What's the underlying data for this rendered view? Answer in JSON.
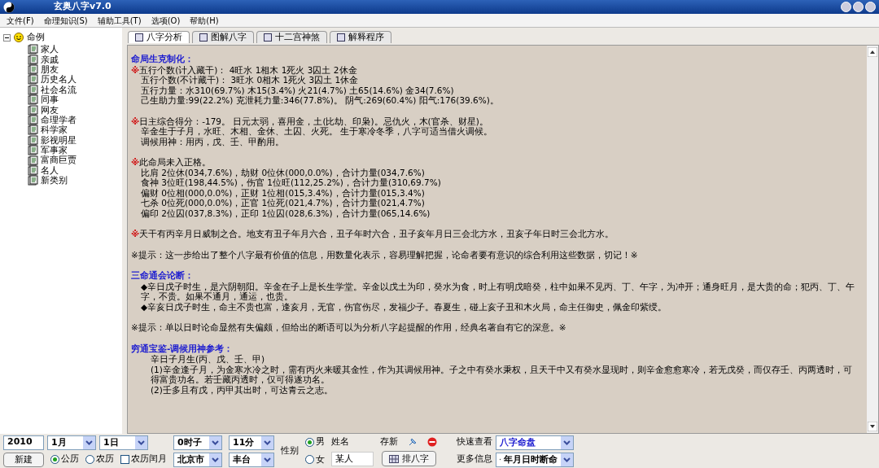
{
  "window": {
    "title": "玄奥八字v7.0"
  },
  "menu": [
    "文件(F)",
    "命理知识(S)",
    "辅助工具(T)",
    "选项(O)",
    "帮助(H)"
  ],
  "tree": {
    "label": "命例",
    "expanded": true,
    "children": [
      {
        "label": "家人"
      },
      {
        "label": "亲戚"
      },
      {
        "label": "朋友"
      },
      {
        "label": "历史名人"
      },
      {
        "label": "社会名流"
      },
      {
        "label": "同事"
      },
      {
        "label": "网友"
      },
      {
        "label": "命理学者"
      },
      {
        "label": "科学家"
      },
      {
        "label": "影视明星"
      },
      {
        "label": "军事家"
      },
      {
        "label": "富商巨贾"
      },
      {
        "label": "名人"
      },
      {
        "label": "新类别"
      }
    ]
  },
  "tabs": [
    {
      "label": "八字分析",
      "selected": true
    },
    {
      "label": "图解八字",
      "selected": false
    },
    {
      "label": "十二宫神煞",
      "selected": false
    },
    {
      "label": "解释程序",
      "selected": false
    }
  ],
  "content": [
    {
      "heading": "命局生克制化：",
      "lines": [
        {
          "marker": "※",
          "text": "五行个数(计入藏干)： 4旺水 1相木 1死火 3囚土 2休金"
        },
        {
          "text": "五行个数(不计藏干)： 3旺水 0相木 1死火 3囚土 1休金"
        },
        {
          "text": "五行力量：水310(69.7%)  木15(3.4%)  火21(4.7%)  土65(14.6%)  金34(7.6%)"
        },
        {
          "text": "己生助力量:99(22.2%)  克泄耗力量:346(77.8%)。  阴气:269(60.4%)  阳气:176(39.6%)。"
        }
      ]
    },
    {
      "lines": [
        {
          "marker": "※",
          "text": "日主综合得分：-179。 日元太弱，喜用金，土(比劫、印枭)。忌仇火，木(官杀、财星)。"
        },
        {
          "text": "辛金生于子月，水旺、木相、金休、土囚、火死。    生于寒冷冬季，八字可适当借火调候。"
        },
        {
          "text": "调候用神：用丙，戊、壬、甲酌用。"
        }
      ]
    },
    {
      "lines": [
        {
          "marker": "※",
          "text": "此命局未入正格。"
        },
        {
          "text": "比肩 2位休(034,7.6%)，劫财 0位休(000,0.0%)，合计力量(034,7.6%)"
        },
        {
          "text": "食神 3位旺(198,44.5%)，伤官 1位旺(112,25.2%)，合计力量(310,69.7%)"
        },
        {
          "text": "偏财 0位相(000,0.0%)，正财 1位相(015,3.4%)，合计力量(015,3.4%)"
        },
        {
          "text": "七杀 0位死(000,0.0%)，正官 1位死(021,4.7%)，合计力量(021,4.7%)"
        },
        {
          "text": "偏印 2位囚(037,8.3%)，正印 1位囚(028,6.3%)，合计力量(065,14.6%)"
        }
      ]
    },
    {
      "lines": [
        {
          "marker": "※",
          "text": "天干有丙辛月日威制之合。地支有丑子年月六合，丑子年时六合，丑子亥年月日三会北方水，丑亥子年日时三会北方水。"
        }
      ]
    },
    {
      "lines": [
        {
          "kind": "note",
          "text": "※提示：这一步给出了整个八字最有价值的信息，用数量化表示，容易理解把握，论命者要有意识的综合利用这些数据，切记！※"
        }
      ]
    },
    {
      "heading": "三命通会论断：",
      "lines": [
        {
          "text": "◆辛日戊子时生，是六阴朝阳。辛金在子上是长生学堂。辛金以戊土为印，癸水为食，时上有明戊暗癸，柱中如果不见丙、丁、午字，为冲开；通身旺月，是大贵的命；犯丙、丁、午字，不贵。如果不通月，通运，也贵。"
        },
        {
          "text": "◆辛亥日戊子时生，命主不贵也富，逢亥月，无官，伤官伤尽，发福少子。春夏生，碰上亥子丑和木火局，命主任御史，佩金印紫绶。"
        }
      ]
    },
    {
      "lines": [
        {
          "kind": "note",
          "text": "※提示：单以日时论命显然有失偏颇，但给出的断语可以为分析八字起提醒的作用，经典名著自有它的深意。※"
        }
      ]
    },
    {
      "heading": "穷通宝鉴-调候用神参考：",
      "lines": [
        {
          "kind": "sub",
          "text": "辛日子月生(丙、戊、壬、甲)"
        },
        {
          "kind": "sub",
          "text": "(1)辛金逢子月，为金寒水冷之时，需有丙火来暖其金性，作为其调候用神。子之中有癸水秉权，且天干中又有癸水显现时，则辛金愈愈寒冷，若无戊癸，而仅存壬、丙两透时，可得富贵功名。若壬藏丙透时，仅可得遂功名。"
        },
        {
          "kind": "sub",
          "text": "(2)壬多且有戊，丙甲其出时，可达青云之志。"
        }
      ]
    }
  ],
  "bottom": {
    "year": "2010",
    "month": "1月",
    "day": "1日",
    "hour": "0时子",
    "minute": "11分",
    "new_button": "新建",
    "calendars": [
      {
        "label": "公历",
        "selected": true
      },
      {
        "label": "农历",
        "selected": false
      }
    ],
    "leap": {
      "label": "农历闰月",
      "checked": false
    },
    "province": "北京市",
    "district": "丰台",
    "gender_label": "性别",
    "genders": [
      {
        "label": "男",
        "selected": true
      },
      {
        "label": "女",
        "selected": false
      }
    ],
    "name_label": "姓名",
    "name_value": "某人",
    "save_label": "存新",
    "chart_button": "排八字",
    "quick_label": "快速查看",
    "quick_value": "八字命盘",
    "more_label": "更多信息",
    "more_value": "年月日时断命"
  }
}
